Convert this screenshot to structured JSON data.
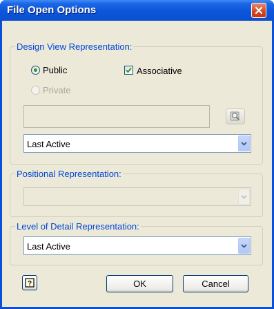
{
  "window": {
    "title": "File Open Options",
    "close_icon": "close-icon"
  },
  "design_view": {
    "legend": "Design View Representation:",
    "public_label": "Public",
    "private_label": "Private",
    "associative_label": "Associative",
    "public_selected": true,
    "private_enabled": false,
    "associative_checked": true,
    "name_value": "",
    "browse_icon": "search-icon",
    "combo_value": "Last Active"
  },
  "positional": {
    "legend": "Positional Representation:",
    "combo_value": "",
    "enabled": false
  },
  "level_of_detail": {
    "legend": "Level of Detail Representation:",
    "combo_value": "Last Active"
  },
  "buttons": {
    "help_icon": "help-icon",
    "ok_label": "OK",
    "cancel_label": "Cancel"
  },
  "colors": {
    "title_bar": "#0a50d8",
    "legend_text": "#0046d5",
    "dialog_face": "#ece9d8",
    "close_button": "#d2451e"
  }
}
